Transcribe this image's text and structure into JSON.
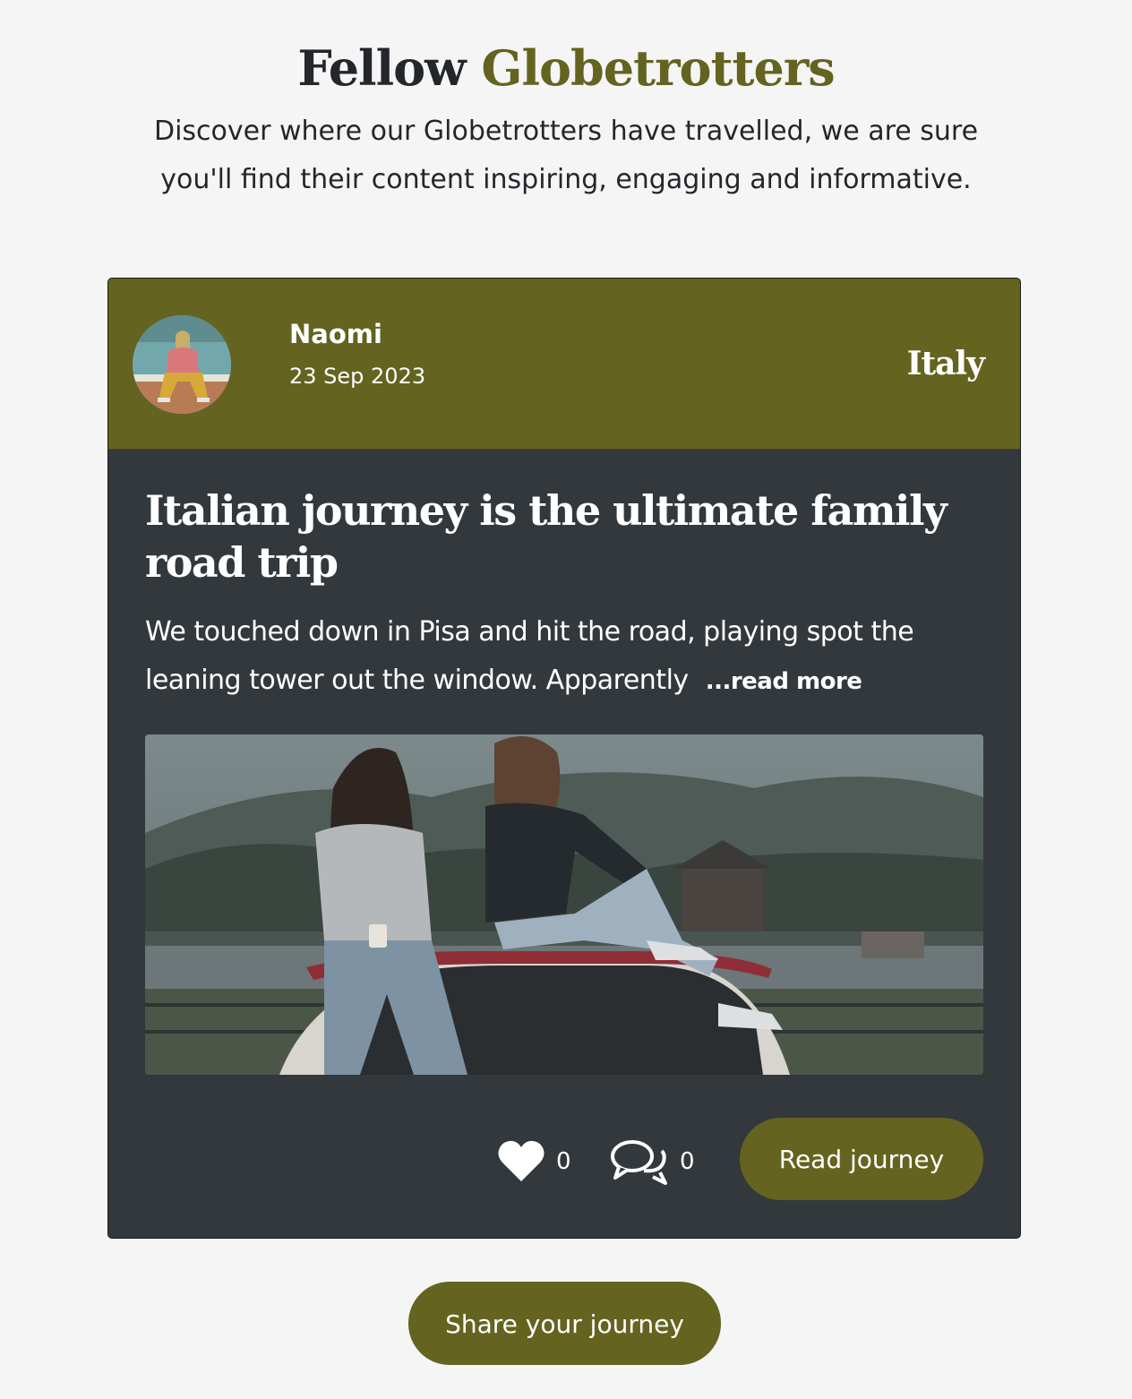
{
  "header": {
    "title_plain": "Fellow",
    "title_accent": "Globetrotters",
    "intro": "Discover where our Globetrotters have travelled, we are sure you'll find their content inspiring, engaging and informative."
  },
  "card": {
    "author": {
      "name": "Naomi",
      "date": "23 Sep 2023",
      "avatar_icon": "user-avatar-photo"
    },
    "country": "Italy",
    "title": "Italian journey is the ultimate family road trip",
    "excerpt": "We touched down in Pisa and hit the road, playing spot the leaning tower out the window. Apparently",
    "read_more_label": "...read more",
    "photo_icon": "road-trip-photo",
    "likes": {
      "icon": "heart-icon",
      "count": "0"
    },
    "comments": {
      "icon": "comments-icon",
      "count": "0"
    },
    "read_button_label": "Read journey"
  },
  "footer": {
    "share_button_label": "Share your journey"
  },
  "colors": {
    "accent": "#646320",
    "card_body": "#33383c",
    "background": "#f5f5f5",
    "text": "#23272b"
  }
}
